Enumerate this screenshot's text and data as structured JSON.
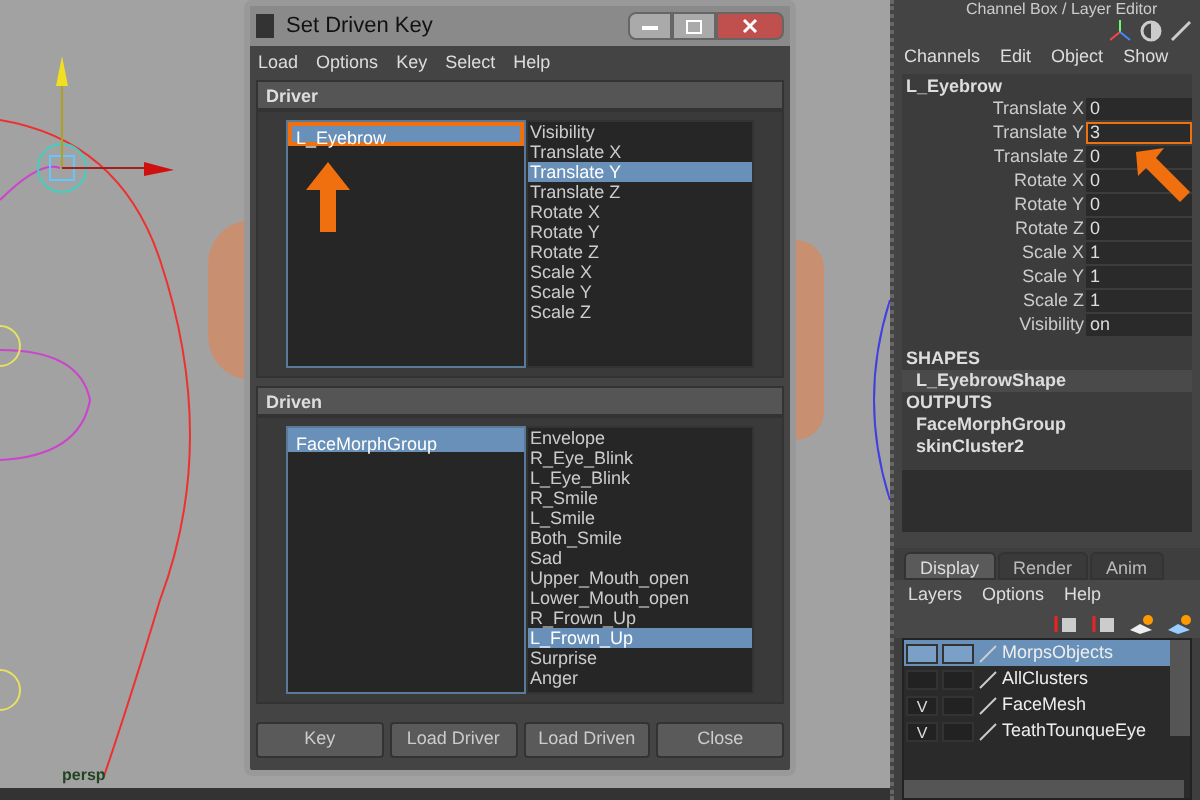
{
  "viewport": {
    "camera_label": "persp"
  },
  "dialog": {
    "title": "Set Driven Key",
    "menu": [
      "Load",
      "Options",
      "Key",
      "Select",
      "Help"
    ],
    "driver": {
      "title": "Driver",
      "objects": [
        {
          "label": "L_Eyebrow",
          "selected": true,
          "highlighted": true
        }
      ],
      "attributes": [
        {
          "label": "Visibility",
          "selected": false
        },
        {
          "label": "Translate X",
          "selected": false
        },
        {
          "label": "Translate Y",
          "selected": true
        },
        {
          "label": "Translate Z",
          "selected": false
        },
        {
          "label": "Rotate X",
          "selected": false
        },
        {
          "label": "Rotate Y",
          "selected": false
        },
        {
          "label": "Rotate Z",
          "selected": false
        },
        {
          "label": "Scale X",
          "selected": false
        },
        {
          "label": "Scale Y",
          "selected": false
        },
        {
          "label": "Scale Z",
          "selected": false
        }
      ]
    },
    "driven": {
      "title": "Driven",
      "objects": [
        {
          "label": "FaceMorphGroup",
          "selected": true,
          "highlighted": false
        }
      ],
      "attributes": [
        {
          "label": "Envelope",
          "selected": false
        },
        {
          "label": "R_Eye_Blink",
          "selected": false
        },
        {
          "label": "L_Eye_Blink",
          "selected": false
        },
        {
          "label": "R_Smile",
          "selected": false
        },
        {
          "label": "L_Smile",
          "selected": false
        },
        {
          "label": "Both_Smile",
          "selected": false
        },
        {
          "label": "Sad",
          "selected": false
        },
        {
          "label": "Upper_Mouth_open",
          "selected": false
        },
        {
          "label": "Lower_Mouth_open",
          "selected": false
        },
        {
          "label": "R_Frown_Up",
          "selected": false
        },
        {
          "label": "L_Frown_Up",
          "selected": true
        },
        {
          "label": "Surprise",
          "selected": false
        },
        {
          "label": "Anger",
          "selected": false
        }
      ]
    },
    "buttons": [
      "Key",
      "Load Driver",
      "Load Driven",
      "Close"
    ]
  },
  "channel_box": {
    "title": "Channel Box / Layer Editor",
    "menu": [
      "Channels",
      "Edit",
      "Object",
      "Show"
    ],
    "object_name": "L_Eyebrow",
    "channels": [
      {
        "label": "Translate X",
        "value": "0",
        "highlighted": false
      },
      {
        "label": "Translate Y",
        "value": "3",
        "highlighted": true
      },
      {
        "label": "Translate Z",
        "value": "0",
        "highlighted": false
      },
      {
        "label": "Rotate X",
        "value": "0",
        "highlighted": false
      },
      {
        "label": "Rotate Y",
        "value": "0",
        "highlighted": false
      },
      {
        "label": "Rotate Z",
        "value": "0",
        "highlighted": false
      },
      {
        "label": "Scale X",
        "value": "1",
        "highlighted": false
      },
      {
        "label": "Scale Y",
        "value": "1",
        "highlighted": false
      },
      {
        "label": "Scale Z",
        "value": "1",
        "highlighted": false
      },
      {
        "label": "Visibility",
        "value": "on",
        "highlighted": false
      }
    ],
    "shapes_heading": "SHAPES",
    "shapes": [
      "L_EyebrowShape"
    ],
    "outputs_heading": "OUTPUTS",
    "outputs": [
      "FaceMorphGroup",
      "skinCluster2"
    ]
  },
  "layer_editor": {
    "tabs": [
      {
        "label": "Display",
        "selected": true
      },
      {
        "label": "Render",
        "selected": false
      },
      {
        "label": "Anim",
        "selected": false
      }
    ],
    "menu": [
      "Layers",
      "Options",
      "Help"
    ],
    "layers": [
      {
        "name": "MorpsObjects",
        "selected": true
      },
      {
        "name": "AllClusters",
        "selected": false
      },
      {
        "name": "FaceMesh",
        "visibility": "V",
        "selected": false
      },
      {
        "name": "TeathTounqueEye",
        "visibility": "V",
        "selected": false
      }
    ]
  }
}
